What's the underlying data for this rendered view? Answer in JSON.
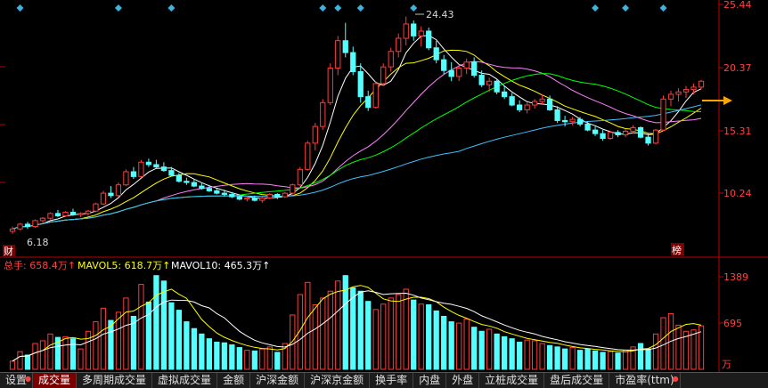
{
  "colors": {
    "background": "#000000",
    "up": "#ff3c3c",
    "down": "#54ffff",
    "axis": "#c00000",
    "price_label": "#ff4040",
    "ma5": "#ffffff",
    "ma10": "#ffff00",
    "ma20": "#ff80ff",
    "ma30": "#00ff00",
    "ma60": "#40c0ff",
    "arrow": "#ffa500",
    "marker": "#3cb4dc"
  },
  "price_axis": {
    "ticks": [
      "25.44",
      "20.37",
      "15.31",
      "10.24"
    ]
  },
  "annotations": {
    "high": "24.43",
    "low": "6.18",
    "badge_left": "财",
    "badge_right": "榜"
  },
  "volume": {
    "total_label": "总手: 658.4万↑",
    "mavol5_label": "MAVOL5: 618.7万↑",
    "mavol10_label": "MAVOL10: 465.3万↑",
    "ticks": [
      "1389",
      "695"
    ],
    "unit": "万"
  },
  "tabs": [
    {
      "label": "设置",
      "dot": true
    },
    {
      "label": "成交量",
      "active": true
    },
    {
      "label": "多周期成交量"
    },
    {
      "label": "虚拟成交量"
    },
    {
      "label": "金额"
    },
    {
      "label": "沪深金额"
    },
    {
      "label": "沪深京金额"
    },
    {
      "label": "换手率"
    },
    {
      "label": "内盘"
    },
    {
      "label": "外盘"
    },
    {
      "label": "立桩成交量"
    },
    {
      "label": "盘后成交量"
    },
    {
      "label": "市盈率(ttm)",
      "dot": true
    }
  ],
  "chart_data": {
    "type": "candlestick",
    "price_range": [
      5.5,
      25.44
    ],
    "volume_range": [
      0,
      1389
    ],
    "volume_unit": "万",
    "candles": [
      [
        6.4,
        6.8,
        6.2,
        6.6,
        120
      ],
      [
        6.6,
        7.1,
        6.5,
        7.0,
        260
      ],
      [
        7.0,
        7.2,
        6.6,
        6.8,
        210
      ],
      [
        6.8,
        7.4,
        6.7,
        7.3,
        380
      ],
      [
        7.3,
        7.6,
        7.1,
        7.5,
        420
      ],
      [
        7.5,
        8.0,
        7.4,
        7.9,
        520
      ],
      [
        7.9,
        8.2,
        7.6,
        7.7,
        470
      ],
      [
        7.7,
        8.1,
        7.6,
        8.0,
        480
      ],
      [
        8.0,
        8.3,
        7.7,
        7.8,
        450
      ],
      [
        7.8,
        8.0,
        7.6,
        7.9,
        300
      ],
      [
        7.9,
        8.2,
        7.7,
        8.1,
        560
      ],
      [
        8.1,
        8.8,
        8.0,
        8.7,
        700
      ],
      [
        8.7,
        9.8,
        8.6,
        9.6,
        900
      ],
      [
        9.6,
        10.2,
        9.2,
        9.4,
        720
      ],
      [
        9.4,
        10.5,
        9.3,
        10.3,
        840
      ],
      [
        10.3,
        11.6,
        10.2,
        11.4,
        1050
      ],
      [
        11.4,
        11.8,
        10.8,
        11.0,
        780
      ],
      [
        11.0,
        12.4,
        10.9,
        12.2,
        1250
      ],
      [
        12.2,
        12.5,
        11.8,
        12.0,
        990
      ],
      [
        12.0,
        12.4,
        11.7,
        11.8,
        1380
      ],
      [
        11.8,
        12.2,
        11.4,
        11.5,
        1300
      ],
      [
        11.5,
        11.8,
        11.0,
        11.1,
        980
      ],
      [
        11.1,
        11.3,
        10.5,
        10.6,
        870
      ],
      [
        10.6,
        10.9,
        10.3,
        10.5,
        700
      ],
      [
        10.5,
        10.8,
        10.1,
        10.2,
        600
      ],
      [
        10.2,
        10.5,
        9.9,
        10.0,
        520
      ],
      [
        10.0,
        10.3,
        9.7,
        9.8,
        450
      ],
      [
        9.8,
        10.0,
        9.5,
        9.6,
        400
      ],
      [
        9.6,
        9.9,
        9.3,
        9.5,
        390
      ],
      [
        9.5,
        9.7,
        9.2,
        9.3,
        360
      ],
      [
        9.3,
        9.5,
        9.0,
        9.1,
        320
      ],
      [
        9.1,
        9.4,
        8.9,
        9.2,
        280
      ],
      [
        9.2,
        9.4,
        8.9,
        9.0,
        270
      ],
      [
        9.0,
        9.3,
        8.8,
        9.2,
        300
      ],
      [
        9.2,
        9.6,
        9.1,
        9.5,
        330
      ],
      [
        9.5,
        9.6,
        9.1,
        9.3,
        250
      ],
      [
        9.3,
        9.7,
        9.2,
        9.6,
        380
      ],
      [
        9.6,
        10.4,
        9.5,
        10.3,
        800
      ],
      [
        10.3,
        11.8,
        10.2,
        11.6,
        1100
      ],
      [
        11.6,
        14.0,
        11.5,
        13.8,
        1280
      ],
      [
        13.8,
        15.5,
        13.2,
        15.2,
        950
      ],
      [
        15.2,
        17.5,
        14.9,
        17.2,
        1050
      ],
      [
        17.2,
        20.5,
        17.0,
        20.1,
        1150
      ],
      [
        20.1,
        22.8,
        19.5,
        22.4,
        1300
      ],
      [
        22.4,
        23.9,
        21.0,
        21.4,
        1380
      ],
      [
        21.4,
        21.9,
        19.5,
        19.8,
        1200
      ],
      [
        19.8,
        20.5,
        17.2,
        17.7,
        1150
      ],
      [
        17.7,
        18.2,
        16.5,
        16.8,
        1000
      ],
      [
        16.8,
        19.0,
        16.7,
        18.8,
        880
      ],
      [
        18.8,
        20.5,
        18.6,
        20.2,
        960
      ],
      [
        20.2,
        21.8,
        19.8,
        21.5,
        1050
      ],
      [
        21.5,
        23.0,
        21.0,
        22.6,
        1100
      ],
      [
        22.6,
        24.43,
        22.0,
        23.8,
        1180
      ],
      [
        23.8,
        24.1,
        22.4,
        22.8,
        1020
      ],
      [
        22.8,
        23.6,
        21.9,
        23.2,
        960
      ],
      [
        23.2,
        23.5,
        21.6,
        21.8,
        950
      ],
      [
        21.8,
        22.4,
        20.5,
        20.8,
        860
      ],
      [
        20.8,
        21.2,
        19.6,
        19.9,
        780
      ],
      [
        19.9,
        20.6,
        19.0,
        19.4,
        700
      ],
      [
        19.4,
        20.4,
        19.0,
        20.1,
        680
      ],
      [
        20.1,
        20.9,
        19.6,
        20.6,
        740
      ],
      [
        20.6,
        21.0,
        19.3,
        19.5,
        620
      ],
      [
        19.5,
        19.9,
        18.5,
        18.7,
        560
      ],
      [
        18.7,
        19.3,
        18.1,
        19.0,
        590
      ],
      [
        19.0,
        19.2,
        17.9,
        18.1,
        520
      ],
      [
        18.1,
        18.6,
        17.5,
        17.7,
        480
      ],
      [
        17.7,
        18.0,
        16.9,
        17.0,
        450
      ],
      [
        17.0,
        17.4,
        16.4,
        16.6,
        400
      ],
      [
        16.6,
        17.2,
        16.3,
        17.0,
        430
      ],
      [
        17.0,
        17.5,
        16.7,
        17.3,
        420
      ],
      [
        17.3,
        17.9,
        17.0,
        17.5,
        380
      ],
      [
        17.5,
        17.8,
        16.5,
        16.6,
        350
      ],
      [
        16.6,
        16.9,
        15.5,
        15.7,
        330
      ],
      [
        15.7,
        16.1,
        15.2,
        15.6,
        300
      ],
      [
        15.6,
        16.0,
        15.3,
        15.8,
        320
      ],
      [
        15.8,
        16.0,
        15.2,
        15.4,
        280
      ],
      [
        15.4,
        15.6,
        14.8,
        14.9,
        300
      ],
      [
        14.9,
        15.2,
        14.4,
        14.6,
        270
      ],
      [
        14.6,
        14.9,
        14.0,
        14.2,
        250
      ],
      [
        14.2,
        14.8,
        14.1,
        14.7,
        260
      ],
      [
        14.7,
        14.9,
        14.3,
        14.5,
        240
      ],
      [
        14.5,
        15.0,
        14.3,
        14.8,
        280
      ],
      [
        14.8,
        15.3,
        14.6,
        15.1,
        330
      ],
      [
        15.1,
        15.2,
        14.2,
        14.3,
        380
      ],
      [
        14.3,
        14.6,
        13.6,
        13.8,
        300
      ],
      [
        13.8,
        15.0,
        13.7,
        14.9,
        520
      ],
      [
        14.9,
        17.8,
        14.8,
        17.5,
        760
      ],
      [
        17.5,
        18.2,
        16.9,
        17.9,
        820
      ],
      [
        17.9,
        18.4,
        17.3,
        18.1,
        650
      ],
      [
        18.1,
        18.6,
        17.6,
        18.3,
        560
      ],
      [
        18.3,
        18.8,
        17.9,
        18.5,
        580
      ],
      [
        18.5,
        19.1,
        18.3,
        19.0,
        640
      ]
    ],
    "moving_averages": [
      "MA5",
      "MA10",
      "MA20",
      "MA30",
      "MA60"
    ],
    "volume_lines": [
      "MAVOL5",
      "MAVOL10"
    ]
  }
}
